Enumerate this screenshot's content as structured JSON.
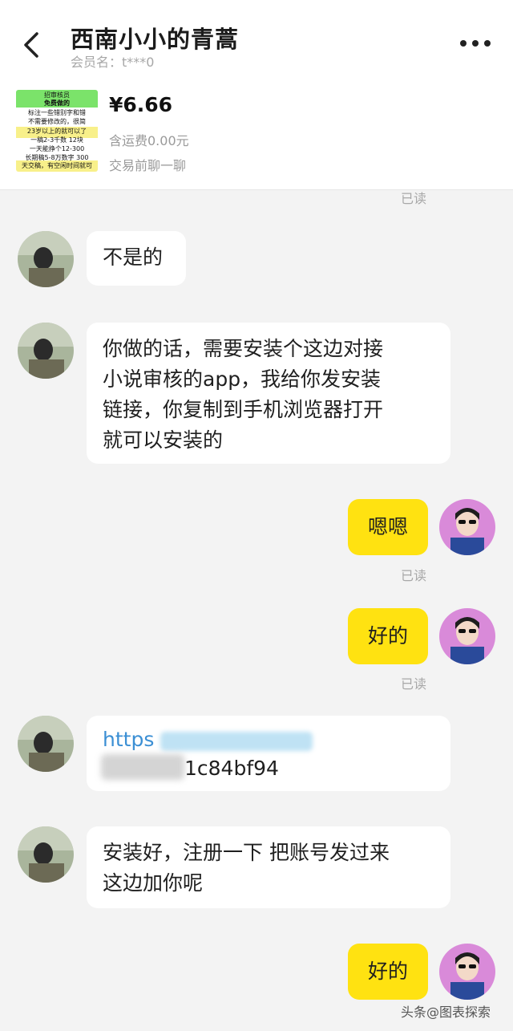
{
  "header": {
    "title": "西南小小的青蒿",
    "member_label": "会员名：t***0",
    "back_icon": "chevron-left-icon",
    "more_icon": "more-dots-icon"
  },
  "item": {
    "price": "¥6.66",
    "shipping": "含运费0.00元",
    "chat_hint": "交易前聊一聊",
    "thumbnail_text": [
      "招审核员",
      "免费做的",
      "标注一些错别字和错",
      "不需要修改的，很简",
      "23岁以上的就可以了",
      "一稿2-3千数 12块",
      "一天能挣个12-300",
      "长期稿5-8万数字 300",
      "天交稿，有空闲时间就可"
    ]
  },
  "messages": {
    "read_label": "已读",
    "m1": "不是的",
    "m2": [
      "你做的话，需要安装个这边对接",
      "小说审核的app，我给你发安装",
      "链接，你复制到手机浏览器打开",
      "就可以安装的"
    ],
    "m3": "嗯嗯",
    "m4": "好的",
    "m5_link": "https",
    "m5_tail": "1c84bf94",
    "m6": [
      "安装好，注册一下  把账号发过来",
      "这边加你呢"
    ],
    "m7": "好的"
  },
  "watermark": "头条@图表探索",
  "colors": {
    "accent_yellow": "#ffe211",
    "link_blue": "#3b8fd4",
    "background": "#f3f3f3"
  }
}
